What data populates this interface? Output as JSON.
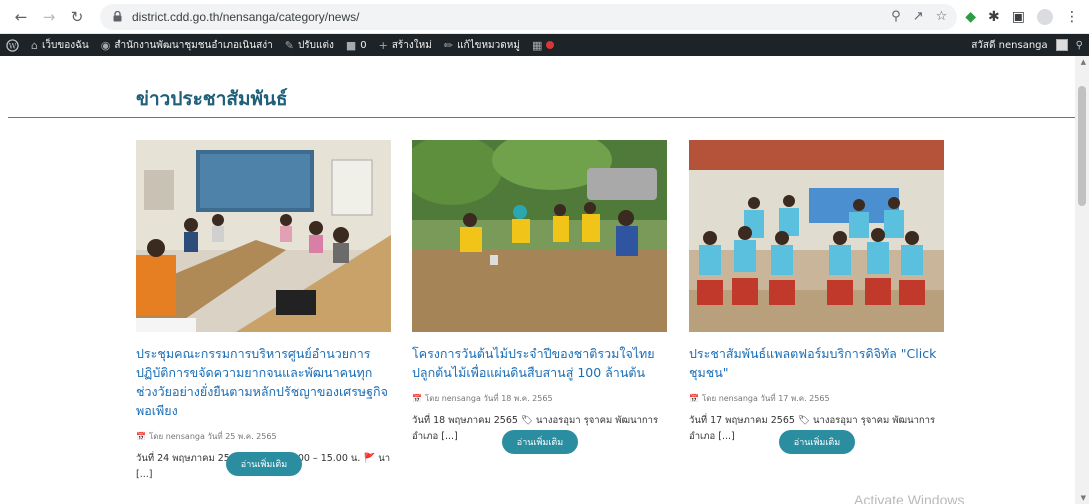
{
  "browser": {
    "url": "district.cdd.go.th/nensanga/category/news/"
  },
  "adminbar": {
    "site_link": "เว็บของฉัน",
    "site_name": "สำนักงานพัฒนาชุมชนอำเภอเนินสง่า",
    "customize": "ปรับแต่ง",
    "comments_count": "0",
    "new": "สร้างใหม่",
    "edit_category": "แก้ไขหมวดหมู่",
    "greeting": "สวัสดี nensanga"
  },
  "page": {
    "heading": "ข่าวประชาสัมพันธ์",
    "watermark": "Activate Windows"
  },
  "cards": [
    {
      "title": "ประชุมคณะกรรมการบริหารศูนย์อำนวยการปฏิบัติการขจัดความยากจนและพัฒนาคนทุกช่วงวัยอย่างยั่งยืนตามหลักปรัชญาของเศรษฐกิจพอเพียง",
      "meta": "โดย nensanga วันที่ 25 พ.ค. 2565",
      "excerpt": "วันที่ 24 พฤษภาคม 2565 ⏰ เวลา 13:00 – 15.00 น. 🚩 นา [...]",
      "button": "อ่านเพิ่มเติม"
    },
    {
      "title": "โครงการวันต้นไม้ประจำปีของชาติรวมใจไทยปลูกต้นไม้เพื่อแผ่นดินสืบสานสู่ 100 ล้านต้น",
      "meta": "โดย nensanga วันที่ 18 พ.ค. 2565",
      "excerpt": "วันที่ 18 พฤษภาคม 2565 🏷 นางอรอุมา รุจาคม พัฒนาการอำเภอ [...]",
      "button": "อ่านเพิ่มเติม"
    },
    {
      "title": "ประชาสัมพันธ์แพลตฟอร์มบริการดิจิทัล \"Click ชุมชน\"",
      "meta": "โดย nensanga วันที่ 17 พ.ค. 2565",
      "excerpt": "วันที่ 17 พฤษภาคม 2565 🏷 นางอรอุมา รุจาคม พัฒนาการอำเภอ [...]",
      "button": "อ่านเพิ่มเติม"
    }
  ]
}
